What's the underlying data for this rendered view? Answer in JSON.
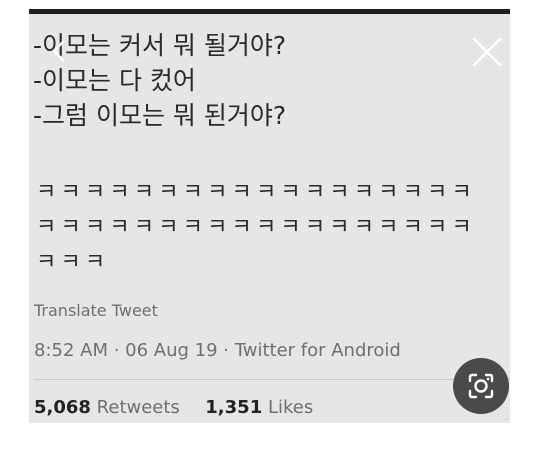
{
  "tweet": {
    "lines": [
      "-이모는 커서 뭐 될거야?",
      "-이모는 다 컸어",
      "-그럼 이모는 뭐 된거야?"
    ],
    "laugh_lines": [
      "ㅋㅋㅋㅋㅋㅋㅋㅋㅋㅋㅋㅋㅋㅋㅋㅋㅋㅋ",
      "ㅋㅋㅋㅋㅋㅋㅋㅋㅋㅋㅋㅋㅋㅋㅋㅋㅋㅋ",
      "ㅋㅋㅋ"
    ],
    "translate_label": "Translate Tweet",
    "meta": "8:52 AM · 06 Aug 19 · Twitter for Android"
  },
  "stats": {
    "retweets_count": "5,068",
    "retweets_label": "Retweets",
    "likes_count": "1,351",
    "likes_label": "Likes"
  },
  "overlay": {
    "close_icon": "close-icon",
    "back_icon": "chevron-left-icon",
    "lens_icon": "image-search-icon"
  },
  "colors": {
    "background": "#e6e6e6",
    "text": "#2a2a2a",
    "muted": "#6f6f6f",
    "lens_button": "#4a4a4a"
  }
}
